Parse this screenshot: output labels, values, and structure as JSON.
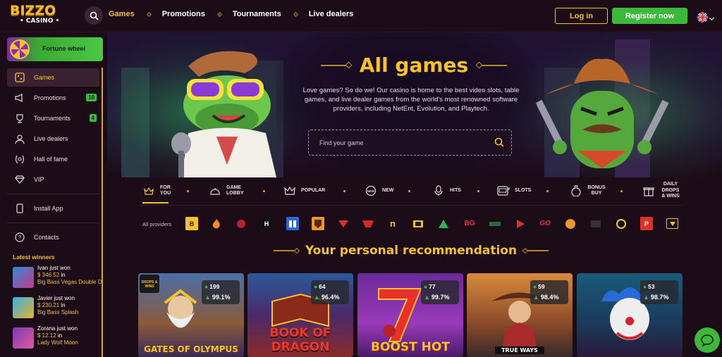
{
  "logo": {
    "line1": "BIZZO",
    "line2": "CASINO"
  },
  "header": {
    "nav": [
      "Games",
      "Promotions",
      "Tournaments",
      "Live dealers"
    ],
    "login": "Log in",
    "register": "Register now"
  },
  "sidebar": {
    "fortune": "Fortune wheel",
    "items": [
      {
        "label": "Games"
      },
      {
        "label": "Promotions",
        "badge": "10"
      },
      {
        "label": "Tournaments",
        "badge": "4"
      },
      {
        "label": "Live dealers"
      },
      {
        "label": "Hall of fame"
      },
      {
        "label": "VIP"
      },
      {
        "label": "Install App"
      },
      {
        "label": "Contacts"
      }
    ],
    "winners_title": "Latest winners",
    "winners": [
      {
        "line1": "Ivan just won",
        "amount": "$ 346.52",
        "suffix": "in",
        "game": "Big Bass Vegas Double Down"
      },
      {
        "line1": "Javier just won",
        "amount": "$ 230.21",
        "suffix": "in",
        "game": "Big Bass Splash"
      },
      {
        "line1": "Zorana just won",
        "amount": "$ 12.12",
        "suffix": "in",
        "game": "Lady Wolf Moon"
      }
    ]
  },
  "hero": {
    "title": "All games",
    "description": "Love games? So do we! Our casino is home to the best video slots, table games, and live dealer games from the world's most renowned software providers, including NetEnt, Evolution, and Playtech.",
    "search_placeholder": "Find your game"
  },
  "categories": [
    "FOR YOU",
    "GAME LOBBY",
    "POPULAR",
    "NEW",
    "HITS",
    "SLOTS",
    "BONUS BUY",
    "DAILY DROPS & WINS"
  ],
  "providers_label": "All providers",
  "providers": [
    "B",
    "",
    "",
    "H",
    "",
    "",
    "",
    "",
    "n",
    "",
    "",
    "BG",
    "",
    "",
    "GO",
    "",
    "",
    "",
    "P"
  ],
  "recommendation_title": "Your personal recommendation",
  "games": [
    {
      "title": "GATES OF OLYMPUS",
      "players": "199",
      "rtp": "99.1%",
      "badge": "DROPS & WINS"
    },
    {
      "title": "BOOK OF DRAGON",
      "players": "64",
      "rtp": "96.4%"
    },
    {
      "title": "BOOST HOT",
      "players": "77",
      "rtp": "99.7%"
    },
    {
      "title": "TRUE WAYS",
      "players": "59",
      "rtp": "98.4%"
    },
    {
      "title": "",
      "players": "53",
      "rtp": "98.7%"
    }
  ],
  "colors": {
    "accent": "#f6c12e",
    "green": "#3cb83b",
    "bg": "#1c0c17"
  }
}
